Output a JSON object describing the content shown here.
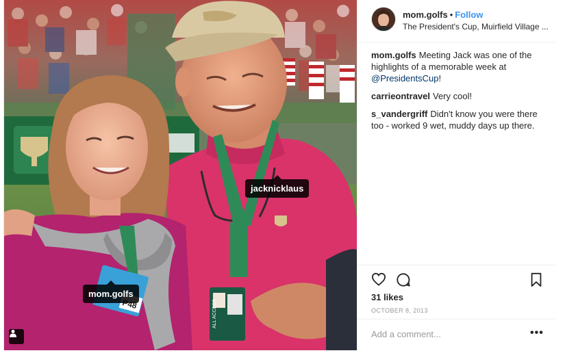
{
  "photo": {
    "tags": [
      {
        "username": "jacknicklaus"
      },
      {
        "username": "mom.golfs"
      }
    ],
    "badge_text": "P48",
    "pass_text": "ALL ACCESS"
  },
  "header": {
    "username": "mom.golfs",
    "separator": "•",
    "follow_label": "Follow",
    "location": "The President's Cup, Muirfield Village ..."
  },
  "comments": [
    {
      "user": "mom.golfs",
      "text": "Meeting Jack was one of the highlights of a memorable week at ",
      "hashtag": "@PresidentsCup",
      "tail": "!"
    },
    {
      "user": "carrieontravel",
      "text": "Very cool!"
    },
    {
      "user": "s_vandergriff",
      "text": "Didn't know you were there too - worked 9 wet, muddy days up there."
    }
  ],
  "actions": {
    "likes": "31 likes",
    "date": "OCTOBER 8, 2013",
    "icons": [
      "heart-icon",
      "comment-icon",
      "bookmark-icon"
    ]
  },
  "add_comment": {
    "placeholder": "Add a comment...",
    "more_label": "•••"
  },
  "colors": {
    "link": "#3897f0",
    "hashtag": "#003569",
    "shirt_pink": "#d9336a",
    "shirt_magenta": "#b3236e",
    "lanyard_green": "#2e8b57"
  }
}
